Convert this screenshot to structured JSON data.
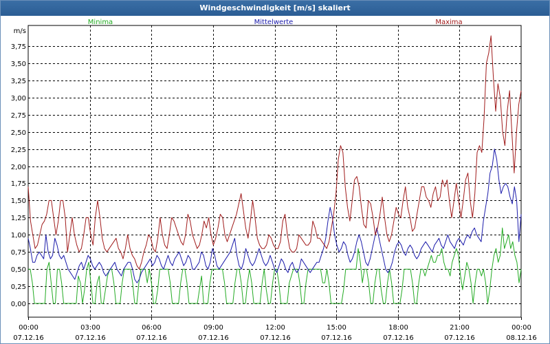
{
  "window": {
    "title": "Windgeschwindigkeit [m/s] skaliert"
  },
  "colors": {
    "minima": "#22aa22",
    "mittelwerte": "#1a1aaa",
    "maxima": "#a01a1a",
    "grid": "#000000",
    "titlebar": "#2f6297"
  },
  "chart_data": {
    "type": "line",
    "title": "Windgeschwindigkeit [m/s] skaliert",
    "ylabel": "m/s",
    "ylim": [
      -0.2,
      4.05
    ],
    "ytick_values": [
      0,
      0.25,
      0.5,
      0.75,
      1.0,
      1.25,
      1.5,
      1.75,
      2.0,
      2.25,
      2.5,
      2.75,
      3.0,
      3.25,
      3.5,
      3.75
    ],
    "ytick_labels": [
      "0,00",
      "0,25",
      "0,50",
      "0,75",
      "1,00",
      "1,25",
      "1,50",
      "1,75",
      "2,00",
      "2,25",
      "2,50",
      "2,75",
      "3,00",
      "3,25",
      "3,50",
      "3,75"
    ],
    "xlim_hours": [
      0,
      24
    ],
    "xtick_hours": [
      0,
      3,
      6,
      9,
      12,
      15,
      18,
      21,
      24
    ],
    "xtick_times": [
      "00:00",
      "03:00",
      "06:00",
      "09:00",
      "12:00",
      "15:00",
      "18:00",
      "21:00",
      "00:00"
    ],
    "xtick_dates": [
      "07.12.16",
      "07.12.16",
      "07.12.16",
      "07.12.16",
      "07.12.16",
      "07.12.16",
      "07.12.16",
      "07.12.16",
      "08.12.16"
    ],
    "grid": true,
    "legend": [
      "Minima",
      "Mittelwerte",
      "Maxima"
    ],
    "series": [
      {
        "name": "Minima",
        "color": "#22aa22",
        "values": [
          0.5,
          0.5,
          0.3,
          0.0,
          0.0,
          0.0,
          0.0,
          0.0,
          0.0,
          0.5,
          0.6,
          0.3,
          0.0,
          0.0,
          0.5,
          0.5,
          0.3,
          0.0,
          0.0,
          0.0,
          0.0,
          0.0,
          0.0,
          0.0,
          0.4,
          0.3,
          0.0,
          0.2,
          0.5,
          0.6,
          0.3,
          0.0,
          0.0,
          0.3,
          0.4,
          0.0,
          0.0,
          0.2,
          0.4,
          0.5,
          0.5,
          0.3,
          0.0,
          0.0,
          0.0,
          0.3,
          0.5,
          0.5,
          0.5,
          0.5,
          0.3,
          0.0,
          0.0,
          0.3,
          0.5,
          0.5,
          0.5,
          0.3,
          0.5,
          0.3,
          0.0,
          0.0,
          0.2,
          0.5,
          0.5,
          0.5,
          0.5,
          0.5,
          0.3,
          0.0,
          0.0,
          0.0,
          0.0,
          0.3,
          0.5,
          0.5,
          0.3,
          0.0,
          0.0,
          0.0,
          0.0,
          0.0,
          0.2,
          0.4,
          0.0,
          0.0,
          0.0,
          0.3,
          0.5,
          0.5,
          0.5,
          0.5,
          0.5,
          0.5,
          0.3,
          0.0,
          0.0,
          0.0,
          0.0,
          0.3,
          0.5,
          0.5,
          0.3,
          0.0,
          0.0,
          0.3,
          0.5,
          0.3,
          0.0,
          0.0,
          0.0,
          0.0,
          0.3,
          0.5,
          0.2,
          0.0,
          0.0,
          0.3,
          0.5,
          0.5,
          0.3,
          0.0,
          0.0,
          0.0,
          0.0,
          0.3,
          0.4,
          0.5,
          0.5,
          0.5,
          0.3,
          0.0,
          0.0,
          0.3,
          0.5,
          0.5,
          0.5,
          0.5,
          0.5,
          0.5,
          0.5,
          0.3,
          0.3,
          0.5,
          0.3,
          0.0,
          0.0,
          0.0,
          0.0,
          0.0,
          0.0,
          0.2,
          0.5,
          0.5,
          0.5,
          0.5,
          0.5,
          0.5,
          0.8,
          0.6,
          0.3,
          0.5,
          0.5,
          0.3,
          0.0,
          0.0,
          0.3,
          0.5,
          0.5,
          0.2,
          0.0,
          0.0,
          0.3,
          0.5,
          0.3,
          0.0,
          0.0,
          0.0,
          0.0,
          0.2,
          0.5,
          0.5,
          0.5,
          0.5,
          0.3,
          0.0,
          0.0,
          0.3,
          0.5,
          0.5,
          0.4,
          0.5,
          0.6,
          0.7,
          0.6,
          0.6,
          0.7,
          0.7,
          0.8,
          0.6,
          0.5,
          0.5,
          0.4,
          0.6,
          0.7,
          0.8,
          0.7,
          0.4,
          0.2,
          0.4,
          0.6,
          0.5,
          0.3,
          0.0,
          0.3,
          0.5,
          0.5,
          0.4,
          0.5,
          0.3,
          0.0,
          0.2,
          0.5,
          0.7,
          0.8,
          0.6,
          0.7,
          1.1,
          0.8,
          0.9,
          1.0,
          0.8,
          0.9,
          0.7,
          0.6,
          0.3,
          0.5
        ]
      },
      {
        "name": "Mittelwerte",
        "color": "#1a1aaa",
        "values": [
          0.95,
          0.8,
          0.6,
          0.6,
          0.7,
          0.75,
          0.7,
          0.65,
          1.0,
          0.75,
          0.65,
          0.7,
          0.95,
          0.85,
          0.7,
          0.65,
          0.7,
          0.6,
          0.5,
          0.45,
          0.4,
          0.35,
          0.45,
          0.55,
          0.6,
          0.5,
          0.6,
          0.7,
          0.65,
          0.55,
          0.5,
          0.55,
          0.6,
          0.55,
          0.45,
          0.4,
          0.45,
          0.5,
          0.55,
          0.6,
          0.5,
          0.45,
          0.4,
          0.5,
          0.55,
          0.6,
          0.6,
          0.5,
          0.35,
          0.3,
          0.35,
          0.45,
          0.5,
          0.55,
          0.6,
          0.65,
          0.55,
          0.6,
          0.7,
          0.65,
          0.55,
          0.5,
          0.6,
          0.7,
          0.6,
          0.55,
          0.65,
          0.7,
          0.75,
          0.65,
          0.55,
          0.6,
          0.7,
          0.65,
          0.5,
          0.5,
          0.55,
          0.6,
          0.75,
          0.7,
          0.55,
          0.5,
          0.6,
          0.8,
          0.7,
          0.55,
          0.5,
          0.55,
          0.6,
          0.65,
          0.7,
          0.75,
          0.85,
          0.95,
          0.7,
          0.55,
          0.5,
          0.6,
          0.8,
          0.7,
          0.6,
          0.55,
          0.6,
          0.7,
          0.8,
          0.7,
          0.6,
          0.55,
          0.6,
          0.7,
          0.6,
          0.5,
          0.45,
          0.55,
          0.65,
          0.6,
          0.5,
          0.45,
          0.55,
          0.6,
          0.5,
          0.45,
          0.5,
          0.65,
          0.6,
          0.55,
          0.5,
          0.45,
          0.5,
          0.55,
          0.6,
          0.6,
          0.7,
          0.8,
          0.95,
          1.2,
          1.4,
          1.25,
          1.0,
          0.85,
          0.75,
          0.8,
          0.9,
          0.85,
          0.7,
          0.6,
          0.65,
          0.75,
          0.9,
          1.0,
          0.9,
          0.75,
          0.6,
          0.55,
          0.65,
          0.8,
          0.95,
          1.1,
          0.95,
          0.8,
          0.65,
          0.5,
          0.45,
          0.5,
          0.6,
          0.75,
          0.85,
          0.9,
          0.85,
          0.75,
          0.7,
          0.8,
          0.85,
          0.8,
          0.7,
          0.65,
          0.7,
          0.8,
          0.85,
          0.9,
          0.85,
          0.8,
          0.75,
          0.85,
          0.9,
          0.95,
          0.85,
          0.8,
          0.9,
          1.0,
          0.9,
          0.85,
          0.8,
          0.9,
          0.95,
          0.9,
          0.85,
          0.95,
          1.0,
          0.95,
          1.05,
          1.1,
          1.0,
          0.95,
          0.9,
          1.2,
          1.4,
          1.6,
          1.9,
          2.0,
          2.25,
          2.1,
          1.8,
          1.6,
          1.7,
          1.75,
          1.7,
          1.55,
          1.45,
          1.7,
          1.5,
          0.9,
          1.3
        ]
      },
      {
        "name": "Maxima",
        "color": "#a01a1a",
        "values": [
          1.7,
          1.2,
          1.0,
          0.8,
          0.85,
          1.0,
          1.15,
          1.2,
          1.3,
          1.5,
          1.5,
          1.25,
          1.0,
          1.2,
          1.5,
          1.5,
          1.25,
          0.75,
          1.0,
          1.25,
          1.0,
          0.85,
          0.75,
          0.8,
          1.0,
          1.25,
          1.25,
          1.0,
          0.85,
          1.25,
          1.5,
          1.25,
          0.95,
          0.8,
          0.75,
          0.8,
          0.85,
          0.9,
          0.95,
          0.8,
          0.75,
          0.65,
          0.8,
          1.0,
          0.8,
          0.7,
          0.65,
          0.55,
          0.5,
          0.6,
          0.75,
          0.85,
          1.0,
          0.95,
          0.8,
          0.75,
          0.95,
          1.25,
          1.0,
          0.85,
          0.8,
          1.0,
          1.25,
          1.2,
          1.1,
          1.0,
          0.9,
          0.85,
          1.0,
          1.3,
          1.2,
          1.0,
          0.9,
          0.8,
          0.85,
          1.0,
          1.2,
          1.1,
          1.25,
          1.0,
          0.85,
          0.95,
          1.1,
          1.3,
          1.25,
          1.0,
          0.9,
          1.0,
          1.1,
          1.2,
          1.3,
          1.45,
          1.6,
          1.35,
          1.1,
          0.95,
          1.2,
          1.5,
          1.25,
          0.95,
          0.85,
          0.8,
          0.8,
          0.85,
          1.0,
          0.95,
          0.85,
          0.8,
          0.8,
          0.9,
          1.2,
          1.3,
          1.0,
          0.8,
          0.75,
          0.75,
          0.8,
          1.0,
          0.95,
          0.9,
          0.85,
          0.85,
          0.9,
          1.2,
          1.1,
          0.95,
          0.95,
          0.9,
          0.85,
          0.8,
          0.9,
          1.1,
          1.3,
          1.6,
          2.1,
          2.3,
          2.2,
          1.7,
          1.4,
          1.2,
          1.5,
          1.8,
          1.85,
          1.7,
          1.4,
          1.15,
          1.1,
          1.5,
          1.45,
          1.25,
          1.0,
          1.1,
          1.3,
          1.55,
          1.25,
          1.0,
          0.9,
          1.0,
          1.2,
          1.4,
          1.3,
          1.25,
          1.5,
          1.7,
          1.4,
          1.25,
          1.05,
          1.1,
          1.3,
          1.5,
          1.7,
          1.7,
          1.55,
          1.5,
          1.4,
          1.6,
          1.7,
          1.5,
          1.55,
          1.8,
          1.7,
          1.8,
          1.5,
          1.25,
          1.5,
          1.75,
          1.5,
          1.25,
          1.5,
          1.8,
          1.9,
          1.5,
          1.25,
          1.6,
          2.2,
          2.3,
          2.2,
          2.7,
          3.5,
          3.65,
          3.9,
          3.3,
          2.8,
          3.2,
          3.0,
          2.5,
          2.3,
          2.8,
          3.1,
          2.5,
          1.9,
          2.5,
          2.9,
          3.1
        ]
      }
    ]
  }
}
